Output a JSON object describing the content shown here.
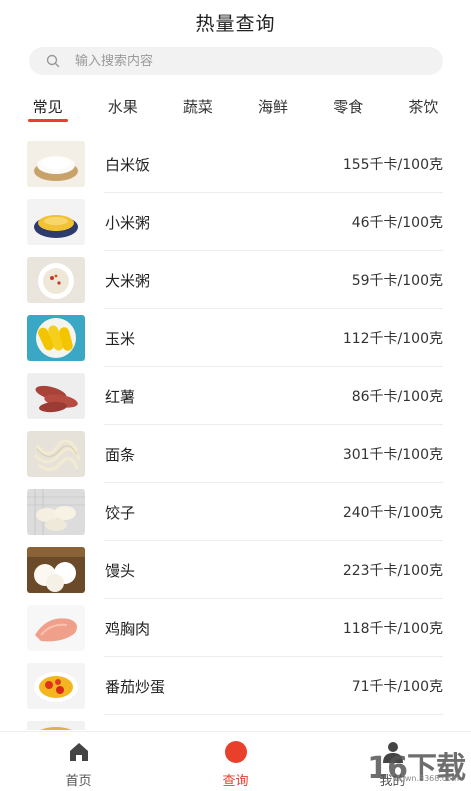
{
  "header": {
    "title": "热量查询"
  },
  "search": {
    "placeholder": "输入搜索内容",
    "icon": "search-icon"
  },
  "tabs": [
    {
      "label": "常见",
      "active": true
    },
    {
      "label": "水果",
      "active": false
    },
    {
      "label": "蔬菜",
      "active": false
    },
    {
      "label": "海鲜",
      "active": false
    },
    {
      "label": "零食",
      "active": false
    },
    {
      "label": "茶饮",
      "active": false
    }
  ],
  "foods": [
    {
      "name": "白米饭",
      "calories": "155千卡/100克"
    },
    {
      "name": "小米粥",
      "calories": "46千卡/100克"
    },
    {
      "name": "大米粥",
      "calories": "59千卡/100克"
    },
    {
      "name": "玉米",
      "calories": "112千卡/100克"
    },
    {
      "name": "红薯",
      "calories": "86千卡/100克"
    },
    {
      "name": "面条",
      "calories": "301千卡/100克"
    },
    {
      "name": "饺子",
      "calories": "240千卡/100克"
    },
    {
      "name": "馒头",
      "calories": "223千卡/100克"
    },
    {
      "name": "鸡胸肉",
      "calories": "118千卡/100克"
    },
    {
      "name": "番茄炒蛋",
      "calories": "71千卡/100克"
    }
  ],
  "tabbar": [
    {
      "label": "首页",
      "icon": "home-icon",
      "active": false
    },
    {
      "label": "查询",
      "icon": "query-icon",
      "active": true
    },
    {
      "label": "我的",
      "icon": "user-icon",
      "active": false
    }
  ],
  "watermark": {
    "text": "16下载",
    "sub": "down.8368.com"
  },
  "colors": {
    "accent": "#e8402a",
    "divider": "#ededed",
    "search_bg": "#f2f2f2"
  }
}
